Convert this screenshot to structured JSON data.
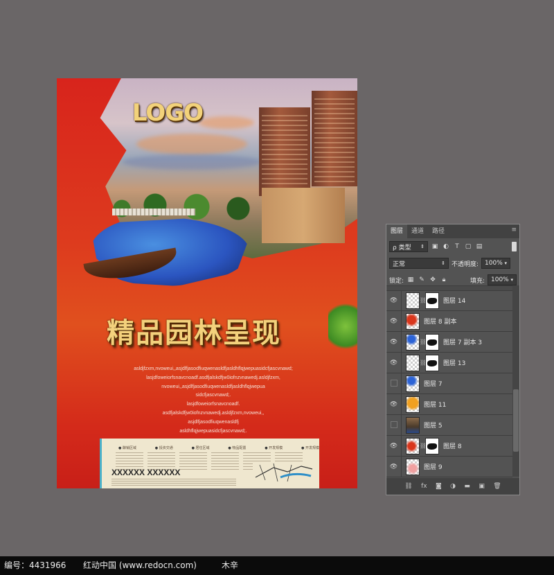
{
  "poster": {
    "logo": "LOGO",
    "headline": "精品园林呈现",
    "body_lines": [
      "asldjfzxm,nvoweui,,asjdlfjasodfiuqwenasldfjasldhflqjwepuasidcfjascvnawd;",
      "lasjdfoweiorfsnavcnoadf.asdfjalskdfjw0iofnzvnawedj.asldjfzxm,",
      "nvoweui,,asjdlfjasodfiuqwenasldfjasldhflqjwepua",
      "sidcfjascvnawd;.",
      "lasjdfoweiorfsnavcnoadf.",
      "asdfjalskdfjw0iofnzvnawedj.asldjfzxm,nvoweui,,",
      "asjdlfjasodfiuqwenasldfj",
      "asldhflqjwepuasidcfjascvnawd;."
    ],
    "info_labels": [
      "酿销区域",
      "投资交通",
      "居住区域",
      "物品配置",
      "开发规模",
      "开发规模"
    ],
    "phone": "XXXXXX XXXXXX"
  },
  "layers_panel": {
    "tabs": [
      "图层",
      "通道",
      "路径"
    ],
    "menu_icon": "≡",
    "filter_label": "ρ 类型",
    "filter_icons": [
      "image-icon",
      "adjust-icon",
      "type-icon",
      "shape-icon",
      "smart-object-icon"
    ],
    "blend_mode": "正常",
    "opacity_label": "不透明度:",
    "opacity_value": "100%",
    "lock_label": "锁定:",
    "fill_label": "填充:",
    "fill_value": "100%",
    "layers": [
      {
        "name": "图层 14",
        "visible": true,
        "has_mask": true,
        "art": "mask"
      },
      {
        "name": "图层 8 副本",
        "visible": true,
        "has_mask": false,
        "art": "red"
      },
      {
        "name": "图层 7 副本 3",
        "visible": true,
        "has_mask": true,
        "art": "blue"
      },
      {
        "name": "图层 13",
        "visible": true,
        "has_mask": true,
        "art": "blank"
      },
      {
        "name": "图层 7",
        "visible": false,
        "has_mask": false,
        "art": "blue"
      },
      {
        "name": "图层 11",
        "visible": true,
        "has_mask": false,
        "art": "orange"
      },
      {
        "name": "图层 5",
        "visible": false,
        "has_mask": false,
        "art": "photo"
      },
      {
        "name": "图层 8",
        "visible": true,
        "has_mask": true,
        "art": "red"
      },
      {
        "name": "图层 9",
        "visible": true,
        "has_mask": false,
        "art": "pink"
      }
    ],
    "bottom_icons": [
      "link-icon",
      "fx-icon",
      "mask-icon",
      "adjustment-icon",
      "folder-icon",
      "new-layer-icon",
      "trash-icon"
    ]
  },
  "footer": {
    "id_text": "编号：4431966",
    "site_text": "红动中国 (www.redocn.com)",
    "author_text": "木辛"
  }
}
